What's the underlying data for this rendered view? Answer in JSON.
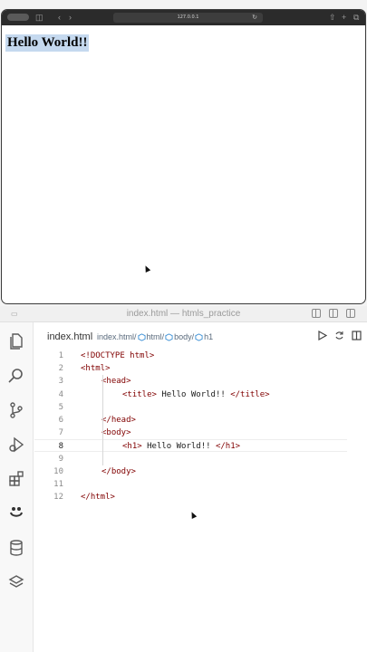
{
  "browser": {
    "url": "127.0.0.1",
    "rendered_heading": "Hello World!!"
  },
  "editor": {
    "window_title": "index.html — htmls_practice",
    "tab": {
      "label": "index.html"
    },
    "breadcrumb": {
      "file": "index.html",
      "sep": "/",
      "items": [
        "html",
        "body",
        "h1"
      ]
    },
    "active_line": 8,
    "lines": [
      {
        "num": "1",
        "code": "<!DOCTYPE html>",
        "indent": 0
      },
      {
        "num": "2",
        "code": "<html>",
        "indent": 0
      },
      {
        "num": "3",
        "code": "<head>",
        "indent": 1
      },
      {
        "num": "4",
        "code": "<title> Hello World!! </title>",
        "indent": 2
      },
      {
        "num": "5",
        "code": "",
        "indent": 2
      },
      {
        "num": "6",
        "code": "</head>",
        "indent": 1
      },
      {
        "num": "7",
        "code": "<body>",
        "indent": 1
      },
      {
        "num": "8",
        "code": "<h1> Hello World!! </h1>",
        "indent": 2
      },
      {
        "num": "9",
        "code": "",
        "indent": 2
      },
      {
        "num": "10",
        "code": "</body>",
        "indent": 1
      },
      {
        "num": "11",
        "code": "",
        "indent": 0
      },
      {
        "num": "12",
        "code": "</html>",
        "indent": 0
      }
    ]
  },
  "activity_bar": {
    "icons": [
      "explorer-icon",
      "search-icon",
      "source-control-icon",
      "run-debug-icon",
      "extensions-icon",
      "live-share-icon",
      "database-icon",
      "layers-icon"
    ]
  },
  "colors": {
    "tag": "#800000",
    "text": "#1a1a1a",
    "line_number": "#8a8a8a"
  }
}
